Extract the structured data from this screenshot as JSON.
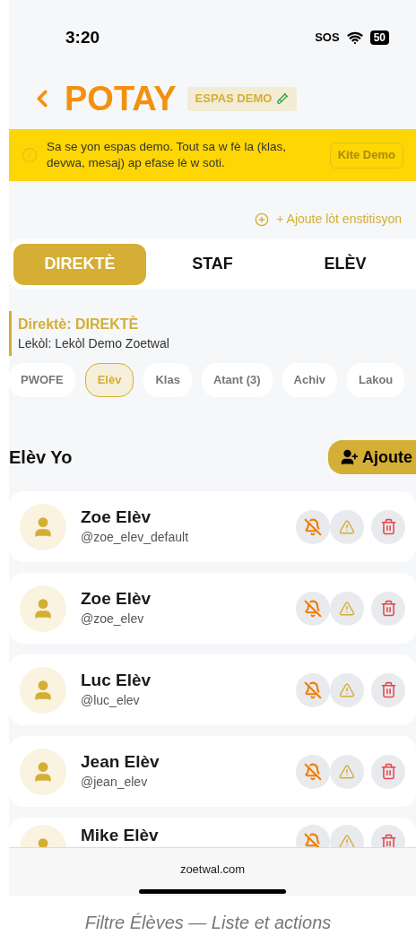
{
  "status_bar": {
    "time": "3:20",
    "sos": "SOS",
    "battery": "50"
  },
  "header": {
    "title": "POTAY",
    "badge": "ESPAS DEMO"
  },
  "demo_banner": {
    "text": "Sa se yon espas demo. Tout sa w fè la (klas, devwa, mesaj) ap efase lè w soti.",
    "button": {
      "label": "Kite Demo",
      "disabled": true
    }
  },
  "add_institution_link": "+ Ajoute lòt enstitisyon",
  "tabs": [
    {
      "label": "DIREKTÈ",
      "selected": true
    },
    {
      "label": "STAF",
      "selected": false
    },
    {
      "label": "ELÈV",
      "selected": false
    }
  ],
  "director": {
    "title": "Direktè: DIREKTÈ",
    "school": "Lekòl: Lekòl Demo Zoetwal"
  },
  "filters": [
    {
      "label": "PWOFE",
      "selected": false
    },
    {
      "label": "Elèv",
      "selected": true
    },
    {
      "label": "Klas",
      "selected": false
    },
    {
      "label": "Atant (3)",
      "selected": false
    },
    {
      "label": "Achiv",
      "selected": false
    },
    {
      "label": "Lakou",
      "selected": false
    }
  ],
  "section": {
    "title": "Elèv Yo",
    "add_button": "Ajoute"
  },
  "students": [
    {
      "name": "Zoe Elèv",
      "handle": "@zoe_elev_default"
    },
    {
      "name": "Zoe Elèv",
      "handle": "@zoe_elev"
    },
    {
      "name": "Luc Elèv",
      "handle": "@luc_elev"
    },
    {
      "name": "Jean Elèv",
      "handle": "@jean_elev"
    },
    {
      "name": "Mike Elèv"
    }
  ],
  "footer": {
    "url": "zoetwal.com"
  },
  "caption": "Filtre Élèves — Liste et actions"
}
